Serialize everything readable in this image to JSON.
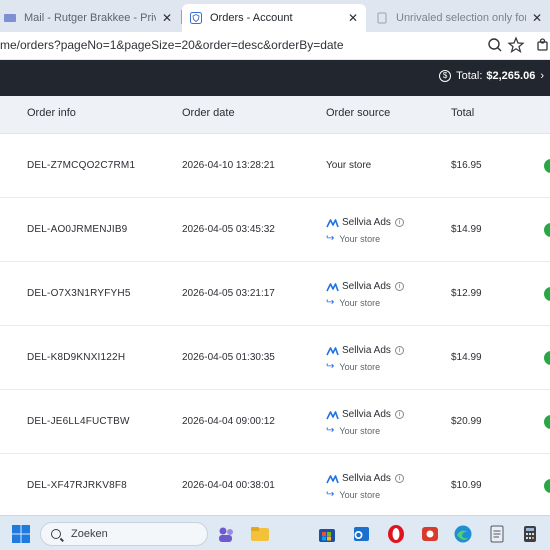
{
  "browser": {
    "tabs": [
      {
        "label": "Mail - Rutger Brakkee - Private Em",
        "close": "✕"
      },
      {
        "label": "Orders - Account",
        "close": "✕"
      },
      {
        "label": "Unrivaled selection only for you",
        "close": "✕"
      }
    ],
    "url": "me/orders?pageNo=1&pageSize=20&order=desc&orderBy=date"
  },
  "header": {
    "total_label": "Total:",
    "total_value": "$2,265.06",
    "chevron": "›",
    "dollar_symbol": "$"
  },
  "table": {
    "columns": [
      "Order info",
      "Order date",
      "Order source",
      "Total"
    ],
    "rows": [
      {
        "id": "DEL-Z7MCQO2C7RM1",
        "date": "2026-04-10 13:28:21",
        "source": "Your store",
        "sub": "",
        "total": "$16.95",
        "mark": "›"
      },
      {
        "id": "DEL-AO0JRMENJIB9",
        "date": "2026-04-05 03:45:32",
        "source": "Sellvia Ads",
        "sub": "Your store",
        "total": "$14.99",
        "mark": "›"
      },
      {
        "id": "DEL-O7X3N1RYFYH5",
        "date": "2026-04-05 03:21:17",
        "source": "Sellvia Ads",
        "sub": "Your store",
        "total": "$12.99",
        "mark": "›"
      },
      {
        "id": "DEL-K8D9KNXI122H",
        "date": "2026-04-05 01:30:35",
        "source": "Sellvia Ads",
        "sub": "Your store",
        "total": "$14.99",
        "mark": "›"
      },
      {
        "id": "DEL-JE6LL4FUCTBW",
        "date": "2026-04-04 09:00:12",
        "source": "Sellvia Ads",
        "sub": "Your store",
        "total": "$20.99",
        "mark": "›"
      },
      {
        "id": "DEL-XF47RJRKV8F8",
        "date": "2026-04-04 00:38:01",
        "source": "Sellvia Ads",
        "sub": "Your store",
        "total": "$10.99",
        "mark": "›"
      }
    ],
    "status_color": "#27a844"
  },
  "taskbar": {
    "search_placeholder": "Zoeken",
    "apps": [
      "windows-start",
      "teams",
      "file-explorer",
      "store",
      "outlook",
      "opera",
      "app-red",
      "edge",
      "notepad",
      "calculator"
    ]
  },
  "colors": {
    "header_bg": "#22262f",
    "table_head_bg": "#eef1f5",
    "accent": "#2f6fd8"
  }
}
